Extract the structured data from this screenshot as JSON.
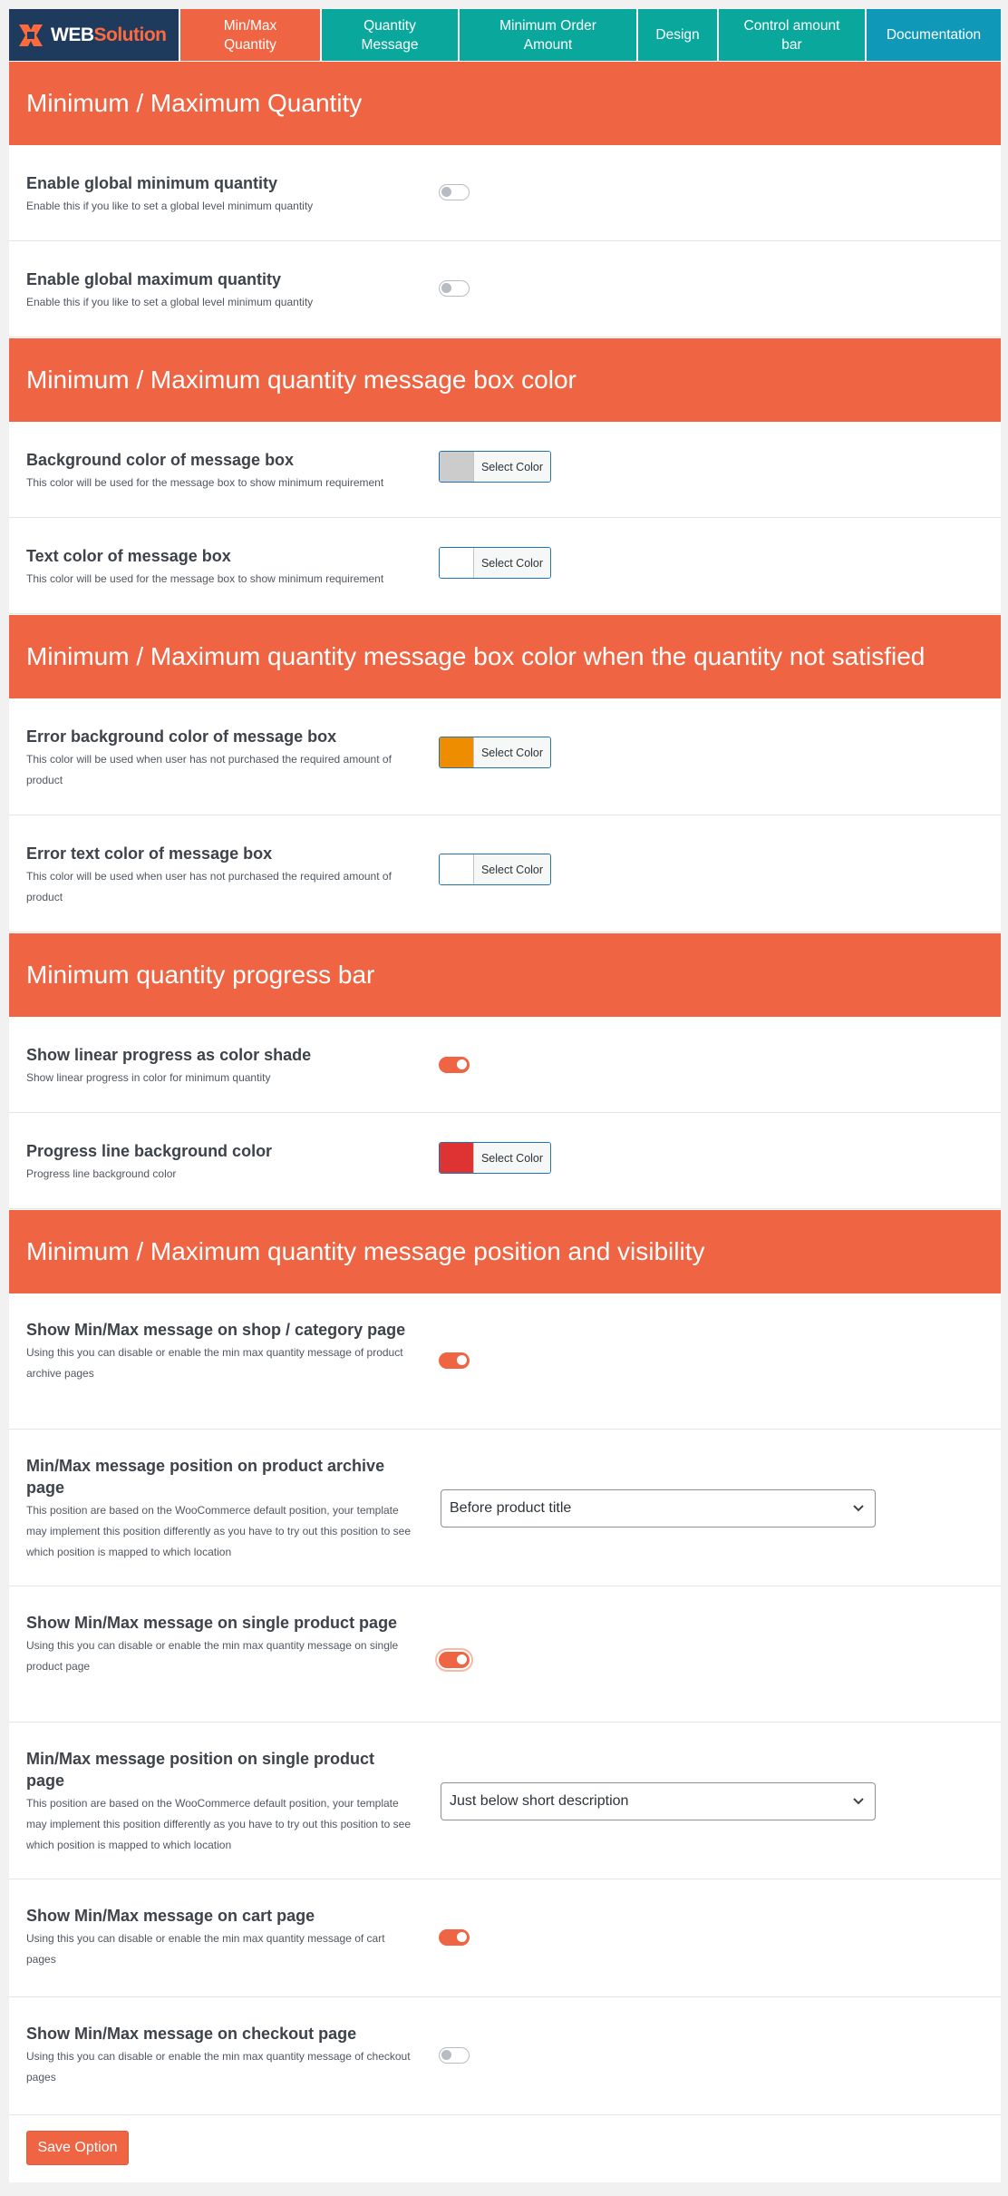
{
  "brand": {
    "word1": "WEB",
    "word2": "Solution"
  },
  "nav": {
    "tabs": [
      {
        "label": "Min/Max\nQuantity",
        "active": true
      },
      {
        "label": "Quantity\nMessage"
      },
      {
        "label": "Minimum Order\nAmount"
      },
      {
        "label": "Design"
      },
      {
        "label": "Control amount\nbar"
      },
      {
        "label": "Documentation"
      }
    ]
  },
  "colors": {
    "accent": "#ef6443",
    "teal": "#0aa89c",
    "docs": "#0f98b8",
    "brand_bg": "#1e3a5c"
  },
  "sections": {
    "s1": {
      "heading": "Minimum / Maximum Quantity",
      "r1": {
        "title": "Enable global minimum quantity",
        "desc": "Enable this if you like to set a global level minimum quantity",
        "state": "off"
      },
      "r2": {
        "title": "Enable global maximum quantity",
        "desc": "Enable this if you like to set a global level minimum quantity",
        "state": "off"
      }
    },
    "s2": {
      "heading": "Minimum / Maximum quantity message box color",
      "r1": {
        "title": "Background color of message box",
        "desc": "This color will be used for the message box to show minimum requirement",
        "button": "Select Color",
        "color": "#cccccc"
      },
      "r2": {
        "title": "Text color of message box",
        "desc": "This color will be used for the message box to show minimum requirement",
        "button": "Select Color",
        "color": "#ffffff"
      }
    },
    "s3": {
      "heading": "Minimum / Maximum quantity message box color when the quantity not satisfied",
      "r1": {
        "title": "Error background color of message box",
        "desc": "This color will be used when user has not purchased the required amount of product",
        "button": "Select Color",
        "color": "#ee8d00"
      },
      "r2": {
        "title": "Error text color of message box",
        "desc": "This color will be used when user has not purchased the required amount of product",
        "button": "Select Color",
        "color": "#ffffff"
      }
    },
    "s4": {
      "heading": "Minimum quantity progress bar",
      "r1": {
        "title": "Show linear progress as color shade",
        "desc": "Show linear progress in color for minimum quantity",
        "state": "on"
      },
      "r2": {
        "title": "Progress line background color",
        "desc": "Progress line background color",
        "button": "Select Color",
        "color": "#dd3333"
      }
    },
    "s5": {
      "heading": "Minimum / Maximum quantity message position and visibility",
      "r1": {
        "title": "Show Min/Max message on shop / category page",
        "desc": "Using this you can disable or enable the min max quantity message of product archive pages",
        "state": "on"
      },
      "r2": {
        "title": "Min/Max message position on product archive page",
        "desc": "This position are based on the WooCommerce default position, your template may implement this position differently as you have to try out this position to see which position is mapped to which location",
        "value": "Before product title"
      },
      "r3": {
        "title": "Show Min/Max message on single product page",
        "desc": "Using this you can disable or enable the min max quantity message on single product page",
        "state": "on"
      },
      "r4": {
        "title": "Min/Max message position on single product page",
        "desc": "This position are based on the WooCommerce default position, your template may implement this position differently as you have to try out this position to see which position is mapped to which location",
        "value": "Just below short description"
      },
      "r5": {
        "title": "Show Min/Max message on cart page",
        "desc": "Using this you can disable or enable the min max quantity message of cart pages",
        "state": "on"
      },
      "r6": {
        "title": "Show Min/Max message on checkout page",
        "desc": "Using this you can disable or enable the min max quantity message of checkout pages",
        "state": "off"
      }
    }
  },
  "save_label": "Save Option"
}
